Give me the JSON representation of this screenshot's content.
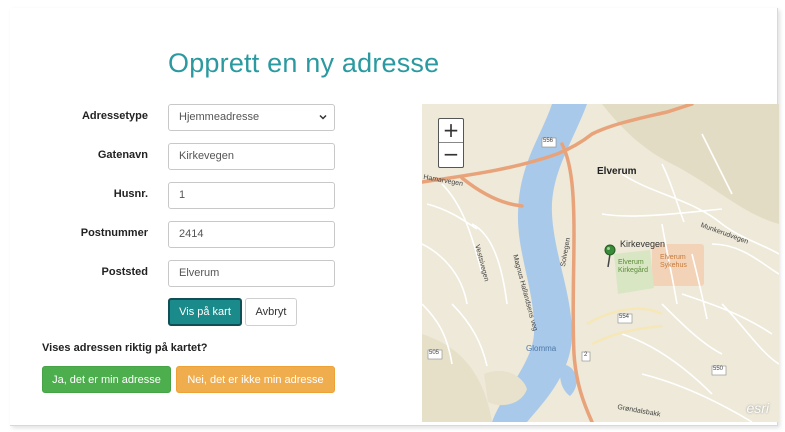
{
  "page": {
    "title": "Opprett en ny adresse"
  },
  "form": {
    "address_type": {
      "label": "Adressetype",
      "value": "Hjemmeadresse"
    },
    "street": {
      "label": "Gatenavn",
      "value": "Kirkevegen"
    },
    "house_number": {
      "label": "Husnr.",
      "value": "1"
    },
    "postal_code": {
      "label": "Postnummer",
      "value": "2414"
    },
    "city": {
      "label": "Poststed",
      "value": "Elverum"
    }
  },
  "actions": {
    "show_on_map": "Vis på kart",
    "cancel": "Avbryt"
  },
  "confirm": {
    "question": "Vises adressen riktig på kartet?",
    "yes": "Ja, det er min adresse",
    "no": "Nei, det er ikke min adresse"
  },
  "map": {
    "zoom_in": "+",
    "zoom_out": "−",
    "labels": {
      "town": "Elverum",
      "street_kirkevegen": "Kirkevegen",
      "kirkegard": "Elverum\nKirkegård",
      "sykehus": "Elverum\nSykehus",
      "river": "Glomma",
      "solvegen": "Solvegen",
      "magnus": "Magnus Hallandsens veg",
      "vestsivegen": "Vestsivegen",
      "hamarvegen": "Hamarvegen",
      "munkerudvegen": "Munkerudvegen",
      "grindal": "Grøndalsbakk",
      "road_556": "556",
      "road_554": "554",
      "road_505": "505",
      "road_2": "2",
      "road_550": "550",
      "attribution": "esri"
    },
    "colors": {
      "water": "#a9c9ea",
      "road_main": "#e8a37a",
      "land": "#eee9d8"
    }
  }
}
